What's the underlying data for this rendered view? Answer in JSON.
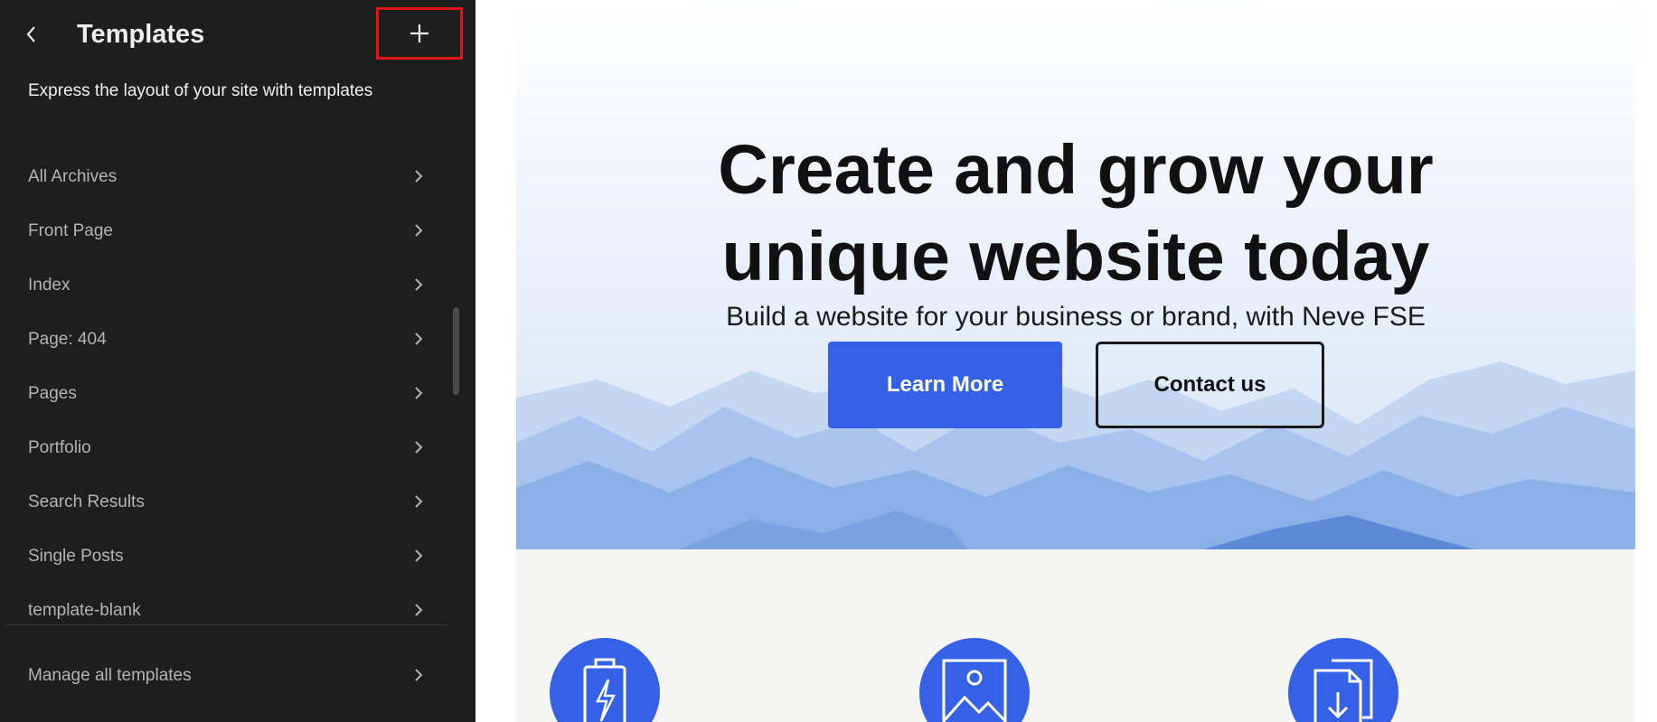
{
  "sidebar": {
    "title": "Templates",
    "description": "Express the layout of your site with templates",
    "back_icon": "chevron-left-icon",
    "add_icon": "plus-icon",
    "items": [
      {
        "label": "All Archives"
      },
      {
        "label": "Front Page"
      },
      {
        "label": "Index"
      },
      {
        "label": "Page: 404"
      },
      {
        "label": "Pages"
      },
      {
        "label": "Portfolio"
      },
      {
        "label": "Search Results"
      },
      {
        "label": "Single Posts"
      },
      {
        "label": "template-blank"
      }
    ],
    "manage_label": "Manage all templates"
  },
  "preview": {
    "hero_title_line1": "Create and grow your",
    "hero_title_line2": "unique website today",
    "hero_subtitle": "Build a website for your business or brand, with Neve FSE",
    "learn_more_label": "Learn More",
    "contact_label": "Contact us",
    "features": [
      {
        "icon": "battery-bolt-icon"
      },
      {
        "icon": "image-icon"
      },
      {
        "icon": "document-download-icon"
      }
    ]
  },
  "colors": {
    "sidebar_bg": "#1e1e1e",
    "accent": "#3461e6",
    "highlight": "#e01616"
  }
}
